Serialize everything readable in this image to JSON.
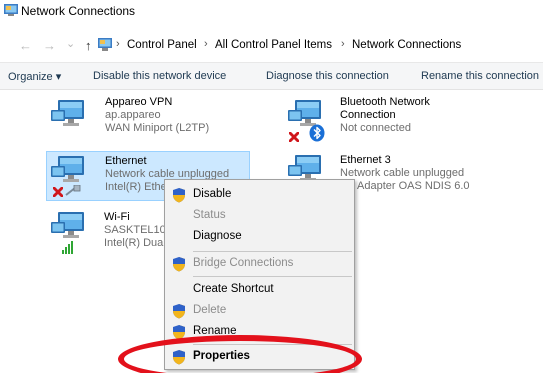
{
  "window": {
    "title": "Network Connections"
  },
  "address": {
    "crumbs": [
      "Control Panel",
      "All Control Panel Items",
      "Network Connections"
    ],
    "separator": "›",
    "back_glyph": "←",
    "forward_glyph": "→",
    "recent_glyph": "⌄",
    "up_glyph": "↑"
  },
  "commands": {
    "organize": "Organize ▾",
    "disable": "Disable this network device",
    "diagnose": "Diagnose this connection",
    "rename": "Rename this connection"
  },
  "connections": [
    {
      "name": "Appareo VPN",
      "line2": "ap.appareo",
      "line3": "WAN Miniport (L2TP)"
    },
    {
      "name": "Bluetooth Network",
      "name_line2": "Connection",
      "line2": "Not connected"
    },
    {
      "name": "Ethernet",
      "line2": "Network cable unplugged",
      "line3": "Intel(R) Ethe"
    },
    {
      "name": "Ethernet 3",
      "line2": "Network cable unplugged",
      "line3": "Adapter OAS NDIS 6.0"
    },
    {
      "name": "Wi-Fi",
      "line2": "SASKTEL109",
      "line3": "Intel(R) Dua"
    }
  ],
  "context_menu": {
    "items": [
      {
        "label": "Disable",
        "shield": true,
        "disabled": false,
        "bold": false
      },
      {
        "label": "Status",
        "shield": false,
        "disabled": true,
        "bold": false
      },
      {
        "label": "Diagnose",
        "shield": false,
        "disabled": false,
        "bold": false
      },
      {
        "label": "Bridge Connections",
        "shield": true,
        "disabled": true,
        "bold": false
      },
      {
        "label": "Create Shortcut",
        "shield": false,
        "disabled": false,
        "bold": false
      },
      {
        "label": "Delete",
        "shield": true,
        "disabled": true,
        "bold": false
      },
      {
        "label": "Rename",
        "shield": true,
        "disabled": false,
        "bold": false
      },
      {
        "label": "Properties",
        "shield": true,
        "disabled": false,
        "bold": true
      }
    ]
  },
  "colors": {
    "selection_bg": "#cce8ff",
    "command_text": "#1e3951",
    "annotation_red": "#e3111b"
  },
  "icons": {
    "title": "network-connections-icon",
    "error": "red-x-icon",
    "bluetooth": "bluetooth-icon",
    "wifi": "wifi-signal-icon",
    "uac": "uac-shield-icon"
  }
}
